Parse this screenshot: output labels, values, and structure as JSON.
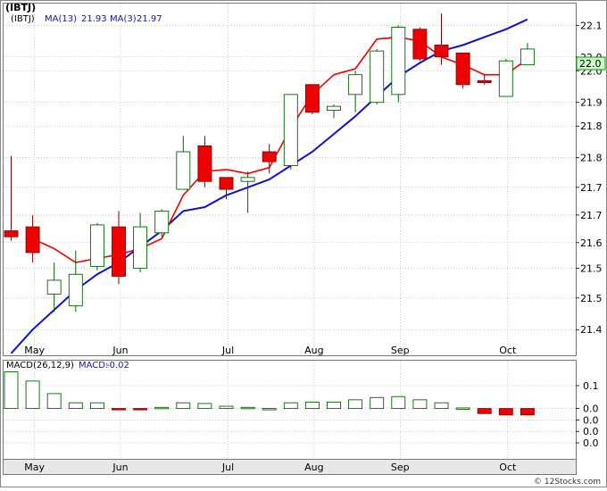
{
  "chart_data": [
    {
      "type": "candlestick",
      "symbol": "(IBTJ)",
      "legend": [
        {
          "label": "MA(13)",
          "value": "21.93",
          "color": "#1111cc"
        },
        {
          "label": "MA(3)",
          "value": "21.97",
          "color": "#1111cc"
        }
      ],
      "price_badge": "22.0",
      "y_ticks": [
        "22.1",
        "22.0",
        "22.0",
        "21.9",
        "21.8",
        "21.8",
        "21.7",
        "21.7",
        "21.6",
        "21.5",
        "21.5",
        "21.4"
      ],
      "y_tick_values": [
        22.11,
        22.03,
        21.995,
        21.915,
        21.855,
        21.775,
        21.7,
        21.63,
        21.56,
        21.495,
        21.42,
        21.34
      ],
      "ylim": [
        21.275,
        22.165
      ],
      "x_labels": [
        {
          "label": "May",
          "index": 1
        },
        {
          "label": "Jun",
          "index": 5
        },
        {
          "label": "Jul",
          "index": 10
        },
        {
          "label": "Aug",
          "index": 14
        },
        {
          "label": "Sep",
          "index": 18
        },
        {
          "label": "Oct",
          "index": 23
        }
      ],
      "candles": [
        {
          "o": 21.59,
          "c": 21.575,
          "h": 21.78,
          "l": 21.565
        },
        {
          "o": 21.6,
          "c": 21.535,
          "h": 21.63,
          "l": 21.51
        },
        {
          "o": 21.43,
          "c": 21.465,
          "h": 21.51,
          "l": 21.385
        },
        {
          "o": 21.4,
          "c": 21.48,
          "h": 21.54,
          "l": 21.385
        },
        {
          "o": 21.5,
          "c": 21.605,
          "h": 21.61,
          "l": 21.49
        },
        {
          "o": 21.6,
          "c": 21.475,
          "h": 21.64,
          "l": 21.455
        },
        {
          "o": 21.495,
          "c": 21.6,
          "h": 21.635,
          "l": 21.485
        },
        {
          "o": 21.585,
          "c": 21.64,
          "h": 21.645,
          "l": 21.575
        },
        {
          "o": 21.695,
          "c": 21.79,
          "h": 21.83,
          "l": 21.695
        },
        {
          "o": 21.805,
          "c": 21.715,
          "h": 21.83,
          "l": 21.7
        },
        {
          "o": 21.725,
          "c": 21.695,
          "h": 21.725,
          "l": 21.67
        },
        {
          "o": 21.715,
          "c": 21.725,
          "h": 21.74,
          "l": 21.635
        },
        {
          "o": 21.79,
          "c": 21.765,
          "h": 21.81,
          "l": 21.735
        },
        {
          "o": 21.755,
          "c": 21.935,
          "h": 21.935,
          "l": 21.745
        },
        {
          "o": 21.96,
          "c": 21.89,
          "h": 21.96,
          "l": 21.885
        },
        {
          "o": 21.895,
          "c": 21.905,
          "h": 21.91,
          "l": 21.875
        },
        {
          "o": 21.935,
          "c": 21.985,
          "h": 21.995,
          "l": 21.89
        },
        {
          "o": 21.915,
          "c": 22.045,
          "h": 22.05,
          "l": 21.91
        },
        {
          "o": 21.935,
          "c": 22.105,
          "h": 22.11,
          "l": 21.915
        },
        {
          "o": 22.1,
          "c": 22.025,
          "h": 22.105,
          "l": 22.02
        },
        {
          "o": 22.06,
          "c": 22.03,
          "h": 22.14,
          "l": 22.01
        },
        {
          "o": 22.04,
          "c": 21.96,
          "h": 22.04,
          "l": 21.95
        },
        {
          "o": 21.97,
          "c": 21.965,
          "h": 21.985,
          "l": 21.96
        },
        {
          "o": 21.93,
          "c": 22.02,
          "h": 22.025,
          "l": 21.93
        },
        {
          "o": 22.01,
          "c": 22.05,
          "h": 22.065,
          "l": 22.01
        }
      ],
      "ma13": [
        21.28,
        21.34,
        21.39,
        21.44,
        21.48,
        21.51,
        21.55,
        21.59,
        21.64,
        21.65,
        21.68,
        21.7,
        21.72,
        21.755,
        21.79,
        21.835,
        21.88,
        21.93,
        21.98,
        22.015,
        22.045,
        22.06,
        22.08,
        22.1,
        22.125
      ],
      "ma3": [
        null,
        21.57,
        21.545,
        21.51,
        21.52,
        21.53,
        21.545,
        21.57,
        21.68,
        21.74,
        21.745,
        21.735,
        21.75,
        21.85,
        21.935,
        21.985,
        22.0,
        22.075,
        22.08,
        22.07,
        22.03,
        22.01,
        21.985,
        21.985,
        22.025
      ]
    },
    {
      "type": "bar",
      "title": "MACD(26,12,9)",
      "legend": [
        {
          "label": "MACD:",
          "value": "-0.02",
          "color": "#1111cc"
        }
      ],
      "y_ticks": [
        "0.1",
        "0.0",
        "0.0",
        "0.0",
        "0.0"
      ],
      "y_tick_values": [
        0.1,
        0.0,
        -0.05,
        -0.1,
        -0.15
      ],
      "ylim": [
        -0.22,
        0.17
      ],
      "values": [
        0.16,
        0.12,
        0.065,
        0.025,
        0.025,
        -0.0025,
        -0.003,
        0.005,
        0.025,
        0.022,
        0.01,
        0.005,
        0.0,
        0.025,
        0.028,
        0.028,
        0.038,
        0.048,
        0.052,
        0.038,
        0.025,
        0.0025,
        -0.022,
        -0.028,
        -0.028
      ]
    }
  ],
  "x_labels_lower": [
    "May",
    "Jun",
    "Jul",
    "Aug",
    "Sep",
    "Oct"
  ],
  "watermark": "© 12Stocks.com",
  "colors": {
    "up_fill": "#ffffff",
    "up_stroke": "#006600",
    "down_fill": "#ee0000",
    "down_stroke": "#880000",
    "ma13": "#1111cc",
    "ma3": "#ee0000",
    "badge_bg": "#ccffcc",
    "badge_border": "#009900",
    "grid": "#aaaaaa"
  }
}
